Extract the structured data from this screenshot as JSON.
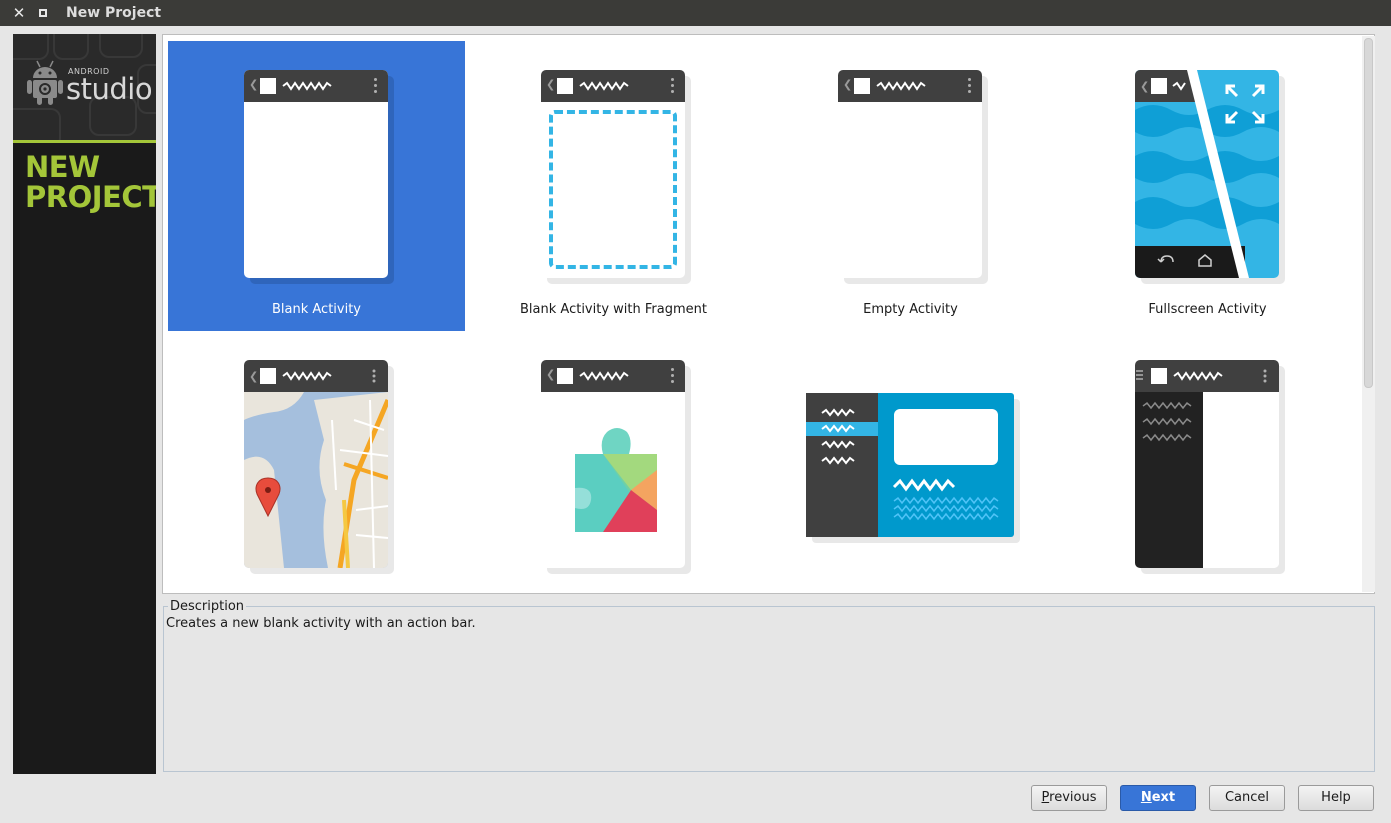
{
  "window": {
    "title": "New Project",
    "close_glyph": "✕"
  },
  "sidebar": {
    "brand_small": "ANDROID",
    "brand_big": "studio",
    "title_line1": "NEW",
    "title_line2": "PROJECT"
  },
  "gallery": {
    "selected_index": 0,
    "tiles": [
      {
        "label": "Blank Activity",
        "thumb": "blank-activity"
      },
      {
        "label": "Blank Activity with Fragment",
        "thumb": "fragment"
      },
      {
        "label": "Empty Activity",
        "thumb": "empty"
      },
      {
        "label": "Fullscreen Activity",
        "thumb": "fullscreen"
      },
      {
        "label": "",
        "thumb": "maps"
      },
      {
        "label": "",
        "thumb": "play-services"
      },
      {
        "label": "",
        "thumb": "master-detail"
      },
      {
        "label": "",
        "thumb": "navigation-drawer"
      }
    ]
  },
  "description": {
    "title": "Description",
    "text": "Creates a new blank activity with an action bar."
  },
  "buttons": {
    "previous_mnemonic": "P",
    "previous_rest": "revious",
    "next_mnemonic": "N",
    "next_rest": "ext",
    "cancel": "Cancel",
    "help": "Help"
  },
  "colors": {
    "accent": "#3875d7",
    "android_green": "#a4c639",
    "holo_blue": "#33b5e5",
    "actionbar": "#404040"
  }
}
